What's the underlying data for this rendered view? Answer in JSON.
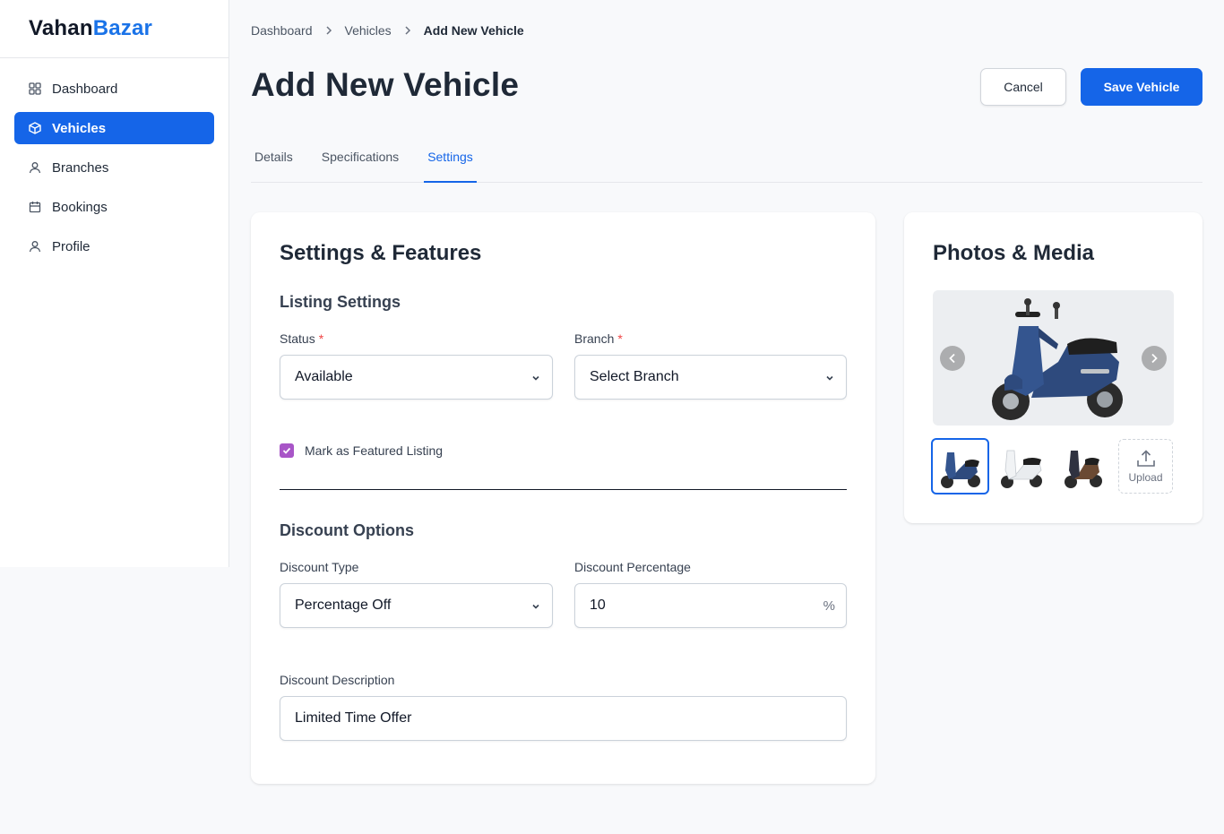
{
  "brand": {
    "part1": "Vahan",
    "part2": "Bazar"
  },
  "sidebar": {
    "items": [
      {
        "label": "Dashboard",
        "icon": "grid-icon"
      },
      {
        "label": "Vehicles",
        "icon": "box-icon",
        "active": true
      },
      {
        "label": "Branches",
        "icon": "user-icon"
      },
      {
        "label": "Bookings",
        "icon": "calendar-icon"
      },
      {
        "label": "Profile",
        "icon": "user-icon"
      }
    ]
  },
  "breadcrumb": [
    "Dashboard",
    "Vehicles",
    "Add New Vehicle"
  ],
  "header": {
    "title": "Add New Vehicle",
    "cancel_label": "Cancel",
    "save_label": "Save Vehicle"
  },
  "tabs": [
    {
      "label": "Details"
    },
    {
      "label": "Specifications"
    },
    {
      "label": "Settings",
      "active": true
    }
  ],
  "settings": {
    "title": "Settings & Features",
    "listing": {
      "title": "Listing Settings",
      "status_label": "Status",
      "status_value": "Available",
      "branch_label": "Branch",
      "branch_value": "Select Branch",
      "required_mark": "*",
      "featured_label": "Mark as Featured Listing",
      "featured_checked": true
    },
    "discount": {
      "title": "Discount Options",
      "type_label": "Discount Type",
      "type_value": "Percentage Off",
      "percentage_label": "Discount Percentage",
      "percentage_value": "10",
      "percentage_suffix": "%",
      "description_label": "Discount Description",
      "description_value": "Limited Time Offer"
    }
  },
  "media": {
    "title": "Photos & Media",
    "upload_label": "Upload",
    "thumbnails": [
      "blue-scooter",
      "white-scooter",
      "brown-scooter"
    ]
  },
  "colors": {
    "primary": "#1565e8",
    "brand_accent": "#1a73e8",
    "checkbox": "#a855c7",
    "required": "#ef4444"
  }
}
